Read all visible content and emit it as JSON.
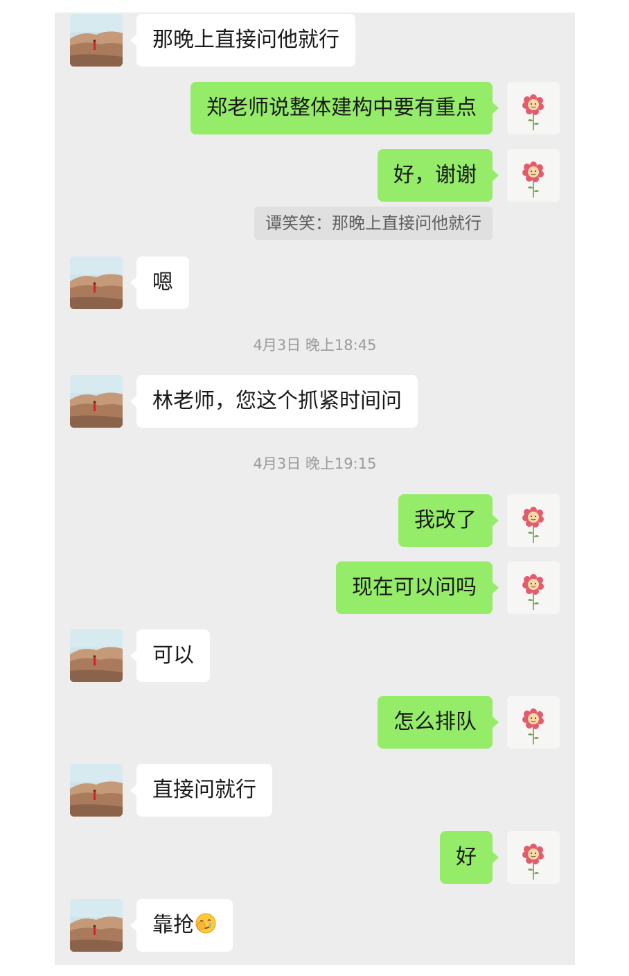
{
  "messages": [
    {
      "side": "in",
      "text": "那晚上直接问他就行"
    },
    {
      "side": "out",
      "text": "郑老师说整体建构中要有重点"
    },
    {
      "side": "out",
      "text": "好，谢谢"
    },
    {
      "quote": "谭笑笑：那晚上直接问他就行"
    },
    {
      "side": "in",
      "text": "嗯"
    },
    {
      "time": "4月3日 晚上18:45"
    },
    {
      "side": "in",
      "text": "林老师，您这个抓紧时间问"
    },
    {
      "time": "4月3日 晚上19:15"
    },
    {
      "side": "out",
      "text": "我改了"
    },
    {
      "side": "out",
      "text": "现在可以问吗"
    },
    {
      "side": "in",
      "text": "可以"
    },
    {
      "side": "out",
      "text": "怎么排队"
    },
    {
      "side": "in",
      "text": "直接问就行"
    },
    {
      "side": "out",
      "text": "好"
    },
    {
      "side": "in",
      "text": "靠抢",
      "emoji": "facepalm-crying-emoji"
    }
  ],
  "colors": {
    "background": "#ededed",
    "outgoing_bubble": "#95ec69",
    "incoming_bubble": "#ffffff",
    "timestamp": "#9a9a9a",
    "quote_background": "#e0e0e0"
  },
  "icons": {
    "contact_avatar": "desert-landscape-avatar",
    "self_avatar": "flower-avatar"
  }
}
